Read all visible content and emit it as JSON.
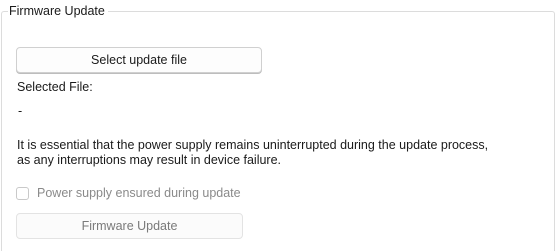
{
  "groupbox": {
    "title": "Firmware Update"
  },
  "select_button": {
    "label": "Select update file"
  },
  "selected_file": {
    "label": "Selected File:",
    "value": "-"
  },
  "warning": {
    "line1": "It is essential that the power supply remains uninterrupted during the update process,",
    "line2": "as any interruptions may result in device failure."
  },
  "power_checkbox": {
    "label": "Power supply ensured during update",
    "checked": false,
    "enabled": false
  },
  "firmware_button": {
    "label": "Firmware Update",
    "enabled": false
  }
}
